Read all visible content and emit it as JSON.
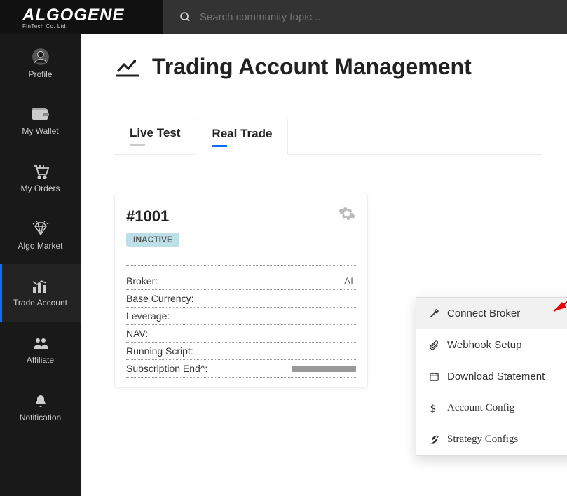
{
  "logo": {
    "text": "ALGOGENE",
    "sub": "FinTech Co. Ltd."
  },
  "search": {
    "placeholder": "Search community topic ..."
  },
  "sidebar": {
    "items": [
      {
        "label": "Profile"
      },
      {
        "label": "My Wallet"
      },
      {
        "label": "My Orders"
      },
      {
        "label": "Algo Market"
      },
      {
        "label": "Trade Account"
      },
      {
        "label": "Affiliate"
      },
      {
        "label": "Notification"
      }
    ]
  },
  "title": "Trading Account Management",
  "tabs": {
    "live": "Live Test",
    "real": "Real Trade"
  },
  "card": {
    "id": "#1001",
    "status": "INACTIVE",
    "rows": {
      "broker": "Broker:",
      "brokerVal": "AL",
      "baseCurrency": "Base Currency:",
      "leverage": "Leverage:",
      "nav": "NAV:",
      "script": "Running Script:",
      "subEnd": "Subscription End^:"
    }
  },
  "menu": {
    "connect": "Connect Broker",
    "webhook": "Webhook Setup",
    "download": "Download Statement",
    "account": "Account Config",
    "strategy": "Strategy Configs"
  }
}
